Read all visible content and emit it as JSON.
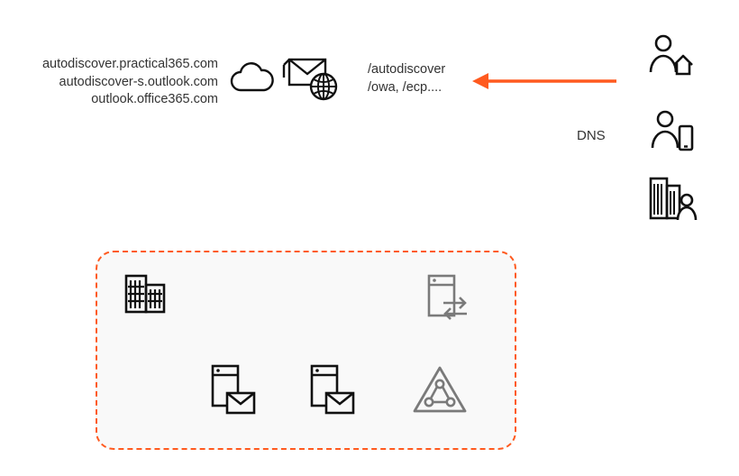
{
  "hostnames": {
    "line1": "autodiscover.practical365.com",
    "line2": "autodiscover-s.outlook.com",
    "line3": "outlook.office365.com"
  },
  "virtual_paths": {
    "line1": "/autodiscover",
    "line2": "/owa, /ecp...."
  },
  "labels": {
    "dns": "DNS"
  },
  "colors": {
    "accent": "#ff5a1f",
    "icon_black": "#111111",
    "icon_grey": "#7a7a7a"
  },
  "icons": {
    "cloud": "cloud",
    "mail_globe": "mail-with-globe",
    "user_home": "person-home",
    "user_phone": "person-phone",
    "user_office": "building-person",
    "building": "buildings",
    "proxy": "server-exchange",
    "mail_server": "server-mail",
    "load_balancer": "triangle-loadbalancer"
  }
}
